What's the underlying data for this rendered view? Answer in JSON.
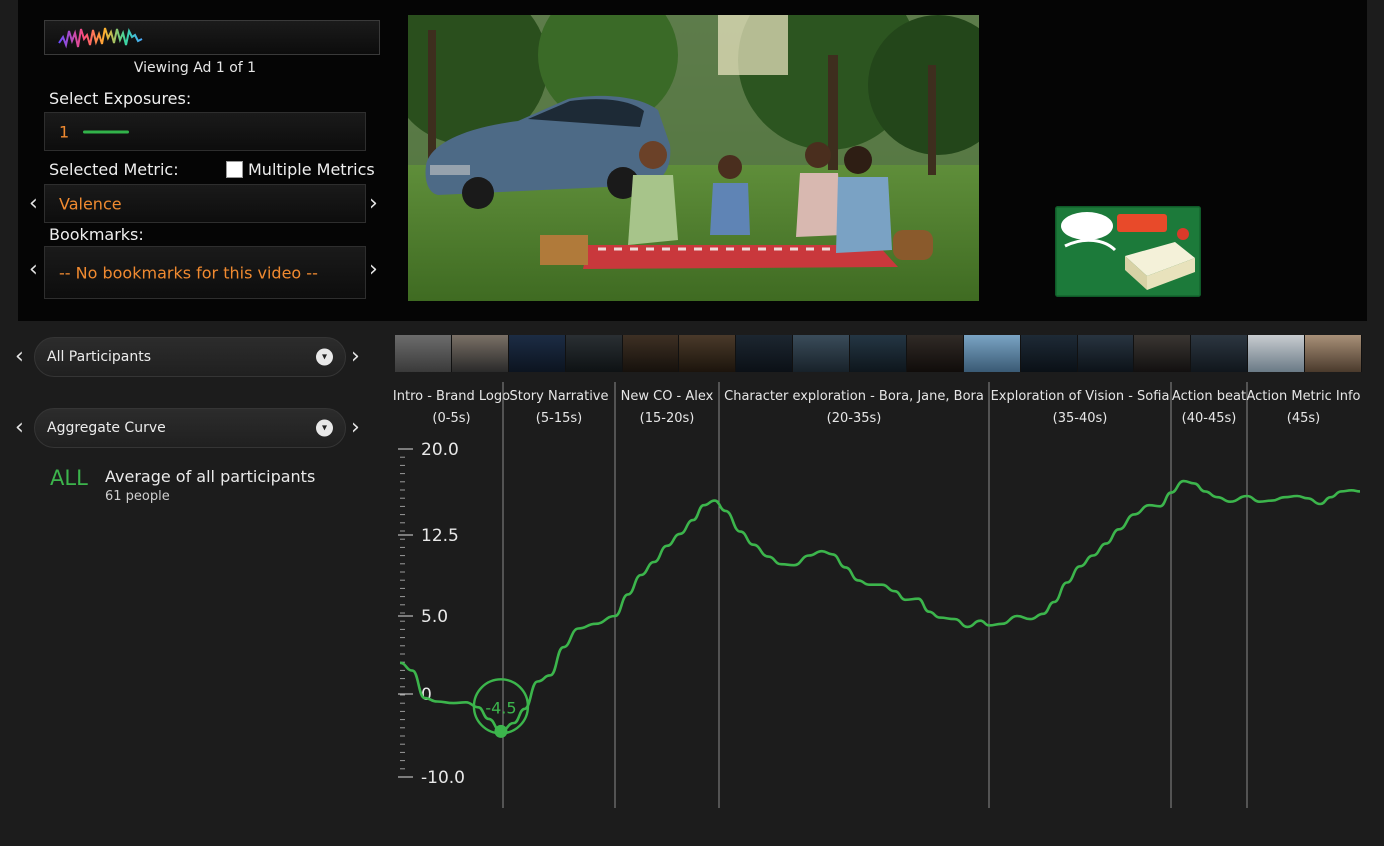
{
  "viewer": {
    "viewing_label": "Viewing Ad 1 of 1",
    "exposures_label": "Select Exposures:",
    "exposures_value": "1",
    "metric_label": "Selected Metric:",
    "multiple_metrics_label": "Multiple Metrics",
    "metric_value": "Valence",
    "bookmarks_label": "Bookmarks:",
    "bookmarks_value": "-- No bookmarks for this video --"
  },
  "filters": {
    "participants": "All Participants",
    "curve_type": "Aggregate Curve"
  },
  "group": {
    "tag": "ALL",
    "title": "Average of all participants",
    "count": "61 people"
  },
  "colors": {
    "accent_orange": "#f08a30",
    "curve_green": "#3cb54c"
  },
  "chart_data": {
    "type": "line",
    "ylim": [
      -10.0,
      20.0
    ],
    "y_ticks": [
      "20.0",
      "12.5",
      "5.0",
      "0",
      "-10.0"
    ],
    "y_tick_values": [
      20.0,
      12.5,
      5.0,
      0,
      -10.0
    ],
    "xlim": [
      0,
      45
    ],
    "segments": [
      {
        "name": "Intro - Brand Logo",
        "time": "(0-5s)",
        "start": 0,
        "end": 5
      },
      {
        "name": "Story Narrative",
        "time": "(5-15s)",
        "start": 5,
        "end": 10.2
      },
      {
        "name": "New CO - Alex",
        "time": "(15-20s)",
        "start": 10.2,
        "end": 15
      },
      {
        "name": "Character exploration - Bora, Jane, Bora",
        "time": "(20-35s)",
        "start": 15,
        "end": 27.6
      },
      {
        "name": "Exploration of Vision - Sofia",
        "time": "(35-40s)",
        "start": 27.6,
        "end": 36
      },
      {
        "name": "Action beat",
        "time": "(40-45s)",
        "start": 36,
        "end": 39.6
      },
      {
        "name": "Action Metric Info",
        "time": "(45s)",
        "start": 39.6,
        "end": 45
      }
    ],
    "marker": {
      "x": 4.9,
      "y": -4.5,
      "label": "-4.5"
    },
    "series": [
      {
        "points": [
          [
            0,
            2.0
          ],
          [
            0.6,
            1.5
          ],
          [
            1.2,
            -0.5
          ],
          [
            1.8,
            -0.9
          ],
          [
            2.6,
            -1.1
          ],
          [
            3.2,
            -1.0
          ],
          [
            3.8,
            -1.6
          ],
          [
            4.3,
            -3.0
          ],
          [
            4.9,
            -4.5
          ],
          [
            5.5,
            -3.5
          ],
          [
            6.0,
            -1.8
          ],
          [
            6.6,
            0.8
          ],
          [
            7.2,
            1.2
          ],
          [
            7.8,
            3.0
          ],
          [
            8.5,
            4.2
          ],
          [
            9.3,
            4.5
          ],
          [
            10.2,
            5.0
          ],
          [
            10.8,
            7.0
          ],
          [
            11.4,
            8.8
          ],
          [
            12.0,
            10.0
          ],
          [
            12.6,
            11.5
          ],
          [
            13.2,
            12.6
          ],
          [
            13.8,
            13.8
          ],
          [
            14.3,
            15.1
          ],
          [
            14.8,
            15.5
          ],
          [
            15.3,
            14.6
          ],
          [
            16.0,
            12.8
          ],
          [
            16.6,
            11.6
          ],
          [
            17.3,
            10.5
          ],
          [
            17.9,
            9.8
          ],
          [
            18.5,
            9.7
          ],
          [
            19.2,
            10.6
          ],
          [
            19.8,
            11.0
          ],
          [
            20.3,
            10.7
          ],
          [
            20.9,
            9.5
          ],
          [
            21.5,
            8.3
          ],
          [
            22.0,
            7.9
          ],
          [
            22.6,
            7.9
          ],
          [
            23.2,
            7.3
          ],
          [
            23.7,
            6.5
          ],
          [
            24.3,
            6.6
          ],
          [
            24.8,
            5.4
          ],
          [
            25.3,
            4.9
          ],
          [
            26.0,
            4.8
          ],
          [
            26.6,
            4.3
          ],
          [
            27.2,
            4.7
          ],
          [
            27.6,
            4.4
          ],
          [
            28.2,
            4.5
          ],
          [
            28.9,
            5.0
          ],
          [
            29.5,
            4.8
          ],
          [
            30.1,
            5.2
          ],
          [
            30.6,
            6.3
          ],
          [
            31.2,
            8.1
          ],
          [
            31.8,
            9.6
          ],
          [
            32.4,
            10.6
          ],
          [
            33.0,
            11.7
          ],
          [
            33.6,
            13.0
          ],
          [
            34.3,
            14.3
          ],
          [
            35.0,
            15.1
          ],
          [
            35.5,
            15.0
          ],
          [
            36.0,
            16.2
          ],
          [
            36.6,
            17.2
          ],
          [
            37.1,
            17.0
          ],
          [
            37.6,
            16.3
          ],
          [
            38.2,
            15.8
          ],
          [
            38.8,
            15.4
          ],
          [
            39.6,
            15.9
          ],
          [
            40.2,
            15.4
          ],
          [
            40.8,
            15.5
          ],
          [
            41.4,
            15.8
          ],
          [
            42.0,
            15.9
          ],
          [
            42.5,
            15.7
          ],
          [
            43.1,
            15.2
          ],
          [
            43.6,
            15.8
          ],
          [
            44.1,
            16.3
          ],
          [
            44.6,
            16.4
          ],
          [
            45.0,
            16.3
          ]
        ]
      }
    ]
  }
}
